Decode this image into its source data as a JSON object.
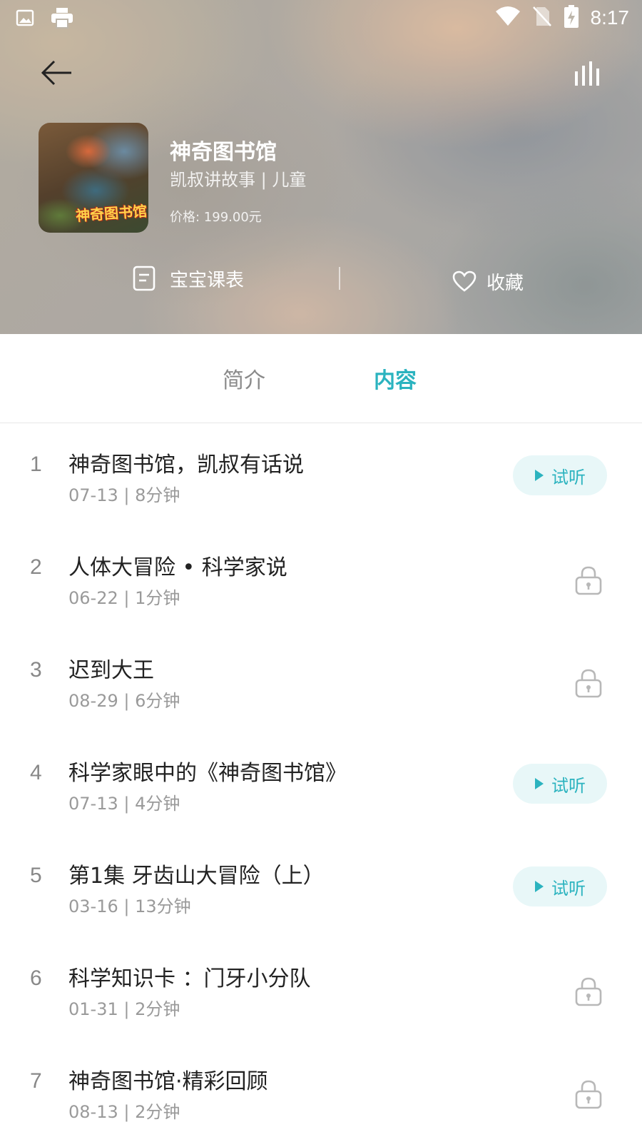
{
  "status_bar": {
    "time": "8:17",
    "left_icons": [
      "image-icon",
      "printer-icon"
    ],
    "right_icons": [
      "wifi-icon",
      "no-sim-icon",
      "battery-charging-icon"
    ]
  },
  "header": {
    "back_icon": "arrow-left-icon",
    "playing_icon": "equalizer-icon",
    "cover_text": "神奇图书馆",
    "title": "神奇图书馆",
    "subtitle": "凯叔讲故事 | 儿童",
    "price": "价格: 199.00元",
    "schedule_label": "宝宝课表",
    "favorite_label": "收藏"
  },
  "tabs": [
    {
      "label": "简介",
      "active": false
    },
    {
      "label": "内容",
      "active": true
    }
  ],
  "episodes": [
    {
      "index": "1",
      "title": "神奇图书馆，凯叔有话说",
      "meta": "07-13 | 8分钟",
      "trial": true
    },
    {
      "index": "2",
      "title": "人体大冒险 • 科学家说",
      "meta": "06-22 | 1分钟",
      "trial": false
    },
    {
      "index": "3",
      "title": "迟到大王",
      "meta": "08-29 | 6分钟",
      "trial": false
    },
    {
      "index": "4",
      "title": "科学家眼中的《神奇图书馆》",
      "meta": "07-13 | 4分钟",
      "trial": true
    },
    {
      "index": "5",
      "title": "第1集 牙齿山大冒险（上）",
      "meta": "03-16 | 13分钟",
      "trial": true
    },
    {
      "index": "6",
      "title": "科学知识卡 ：门牙小分队",
      "meta": "01-31 | 2分钟",
      "trial": false
    },
    {
      "index": "7",
      "title": "神奇图书馆·精彩回顾",
      "meta": "08-13 | 2分钟",
      "trial": false
    }
  ],
  "trial_label": "试听",
  "colors": {
    "accent": "#2bb3bf",
    "trial_bg": "#e8f7f8",
    "title_text": "#222222",
    "meta_text": "#9a9a9a",
    "lock_color": "#b8b8b8"
  }
}
